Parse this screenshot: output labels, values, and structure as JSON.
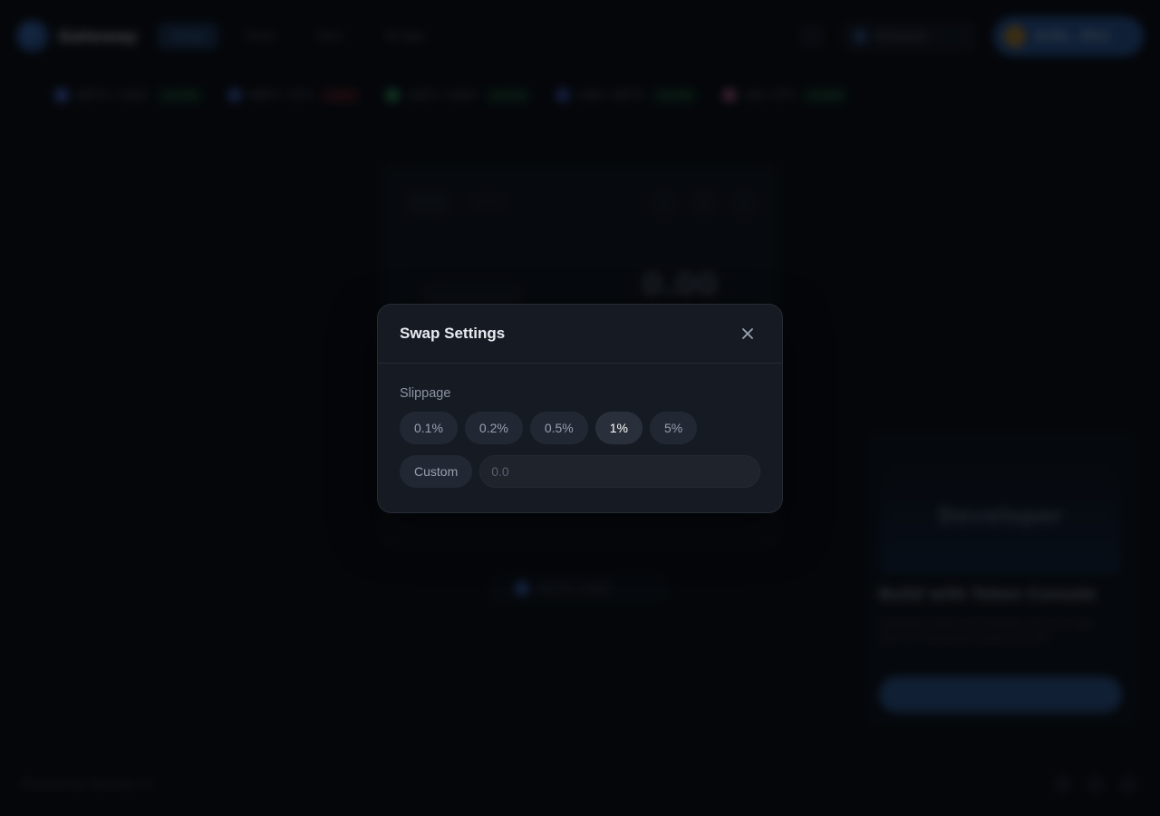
{
  "background": {
    "brand": {
      "name": "Gateway"
    },
    "nav": {
      "links": [
        "Swap",
        "Pools",
        "Earn",
        "Bridge"
      ]
    },
    "network": {
      "label": "Ethereum"
    },
    "wallet": {
      "label": "0x3b...9fa1"
    },
    "ticker": [
      {
        "pair": "WETH / USDC",
        "change": "+1.2%",
        "dir": "up",
        "color": "#4c6fd6"
      },
      {
        "pair": "WBTC / ETH",
        "change": "-0.8%",
        "dir": "down",
        "color": "#3b5fb0"
      },
      {
        "pair": "USDT / USDC",
        "change": "+0.1%",
        "dir": "up",
        "color": "#2e9a5e"
      },
      {
        "pair": "LINK / WETH",
        "change": "+2.4%",
        "dir": "up",
        "color": "#3a56b8"
      },
      {
        "pair": "UNI / ETH",
        "change": "+0.6%",
        "dir": "up",
        "color": "#b05a8a"
      }
    ],
    "swap": {
      "amount": "0.00",
      "token": "WETH"
    },
    "below_pill": "WETH / USDC",
    "promo": {
      "image_text": "Developer",
      "title": "Build with Token Console",
      "text": "Integrate swaps and liquidity into your app with our developer toolkit and API.",
      "button": "Get Started"
    },
    "footer": {
      "text": "Powered by Gateway v2"
    }
  },
  "modal": {
    "title": "Swap Settings",
    "close_icon": "close-icon",
    "slippage_label": "Slippage",
    "options": [
      "0.1%",
      "0.2%",
      "0.5%",
      "1%",
      "5%"
    ],
    "selected": "1%",
    "custom_label": "Custom",
    "custom_value": "",
    "custom_placeholder": "0.0"
  },
  "colors": {
    "modal_bg": "#161b23",
    "chip_bg": "#222833",
    "chip_selected_text": "#ffffff",
    "label_text": "#8b94a3"
  }
}
